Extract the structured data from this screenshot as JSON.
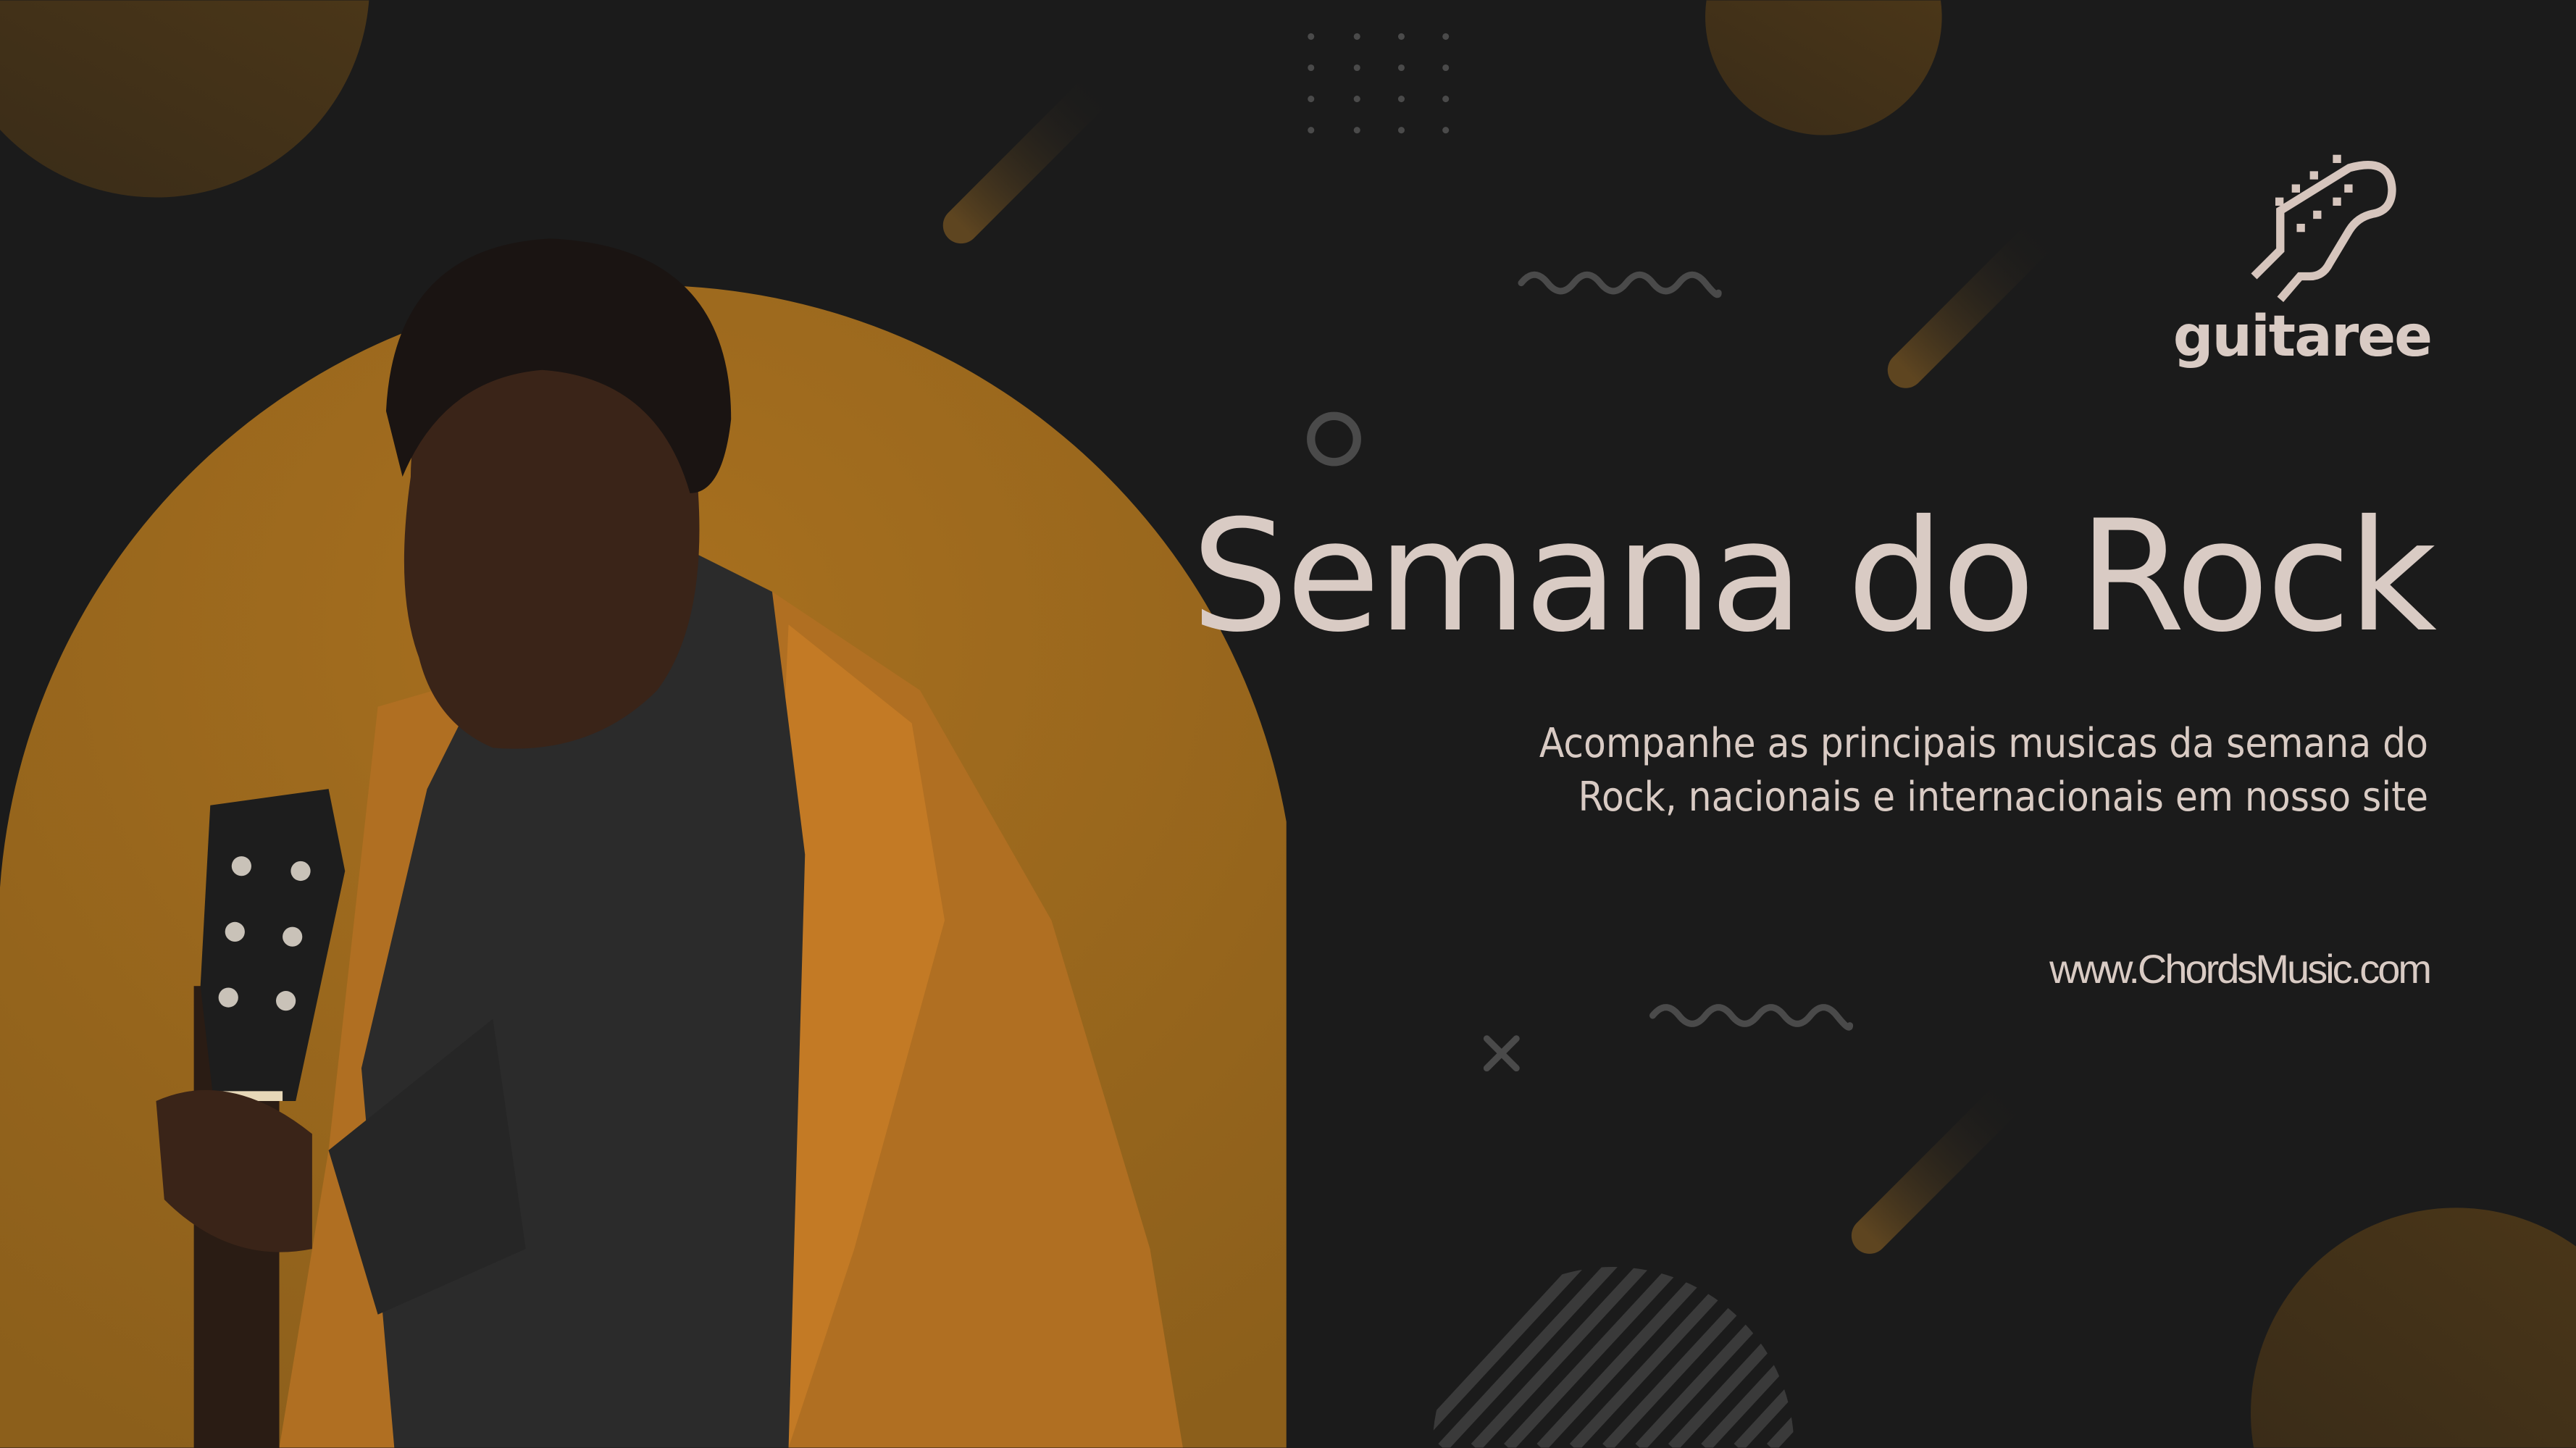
{
  "headline": "Semana do Rock",
  "description_lines": [
    "Acompanhe as principais musicas da semana do",
    "Rock, nacionais e internacionais em nosso site"
  ],
  "website": "www.ChordsMusic.com",
  "logo": {
    "text": "guitaree",
    "icon": "guitar-headstock-icon"
  },
  "colors": {
    "background": "#1b1b1b",
    "accent": "#9c6a1e",
    "text": "#d9cbc4"
  }
}
